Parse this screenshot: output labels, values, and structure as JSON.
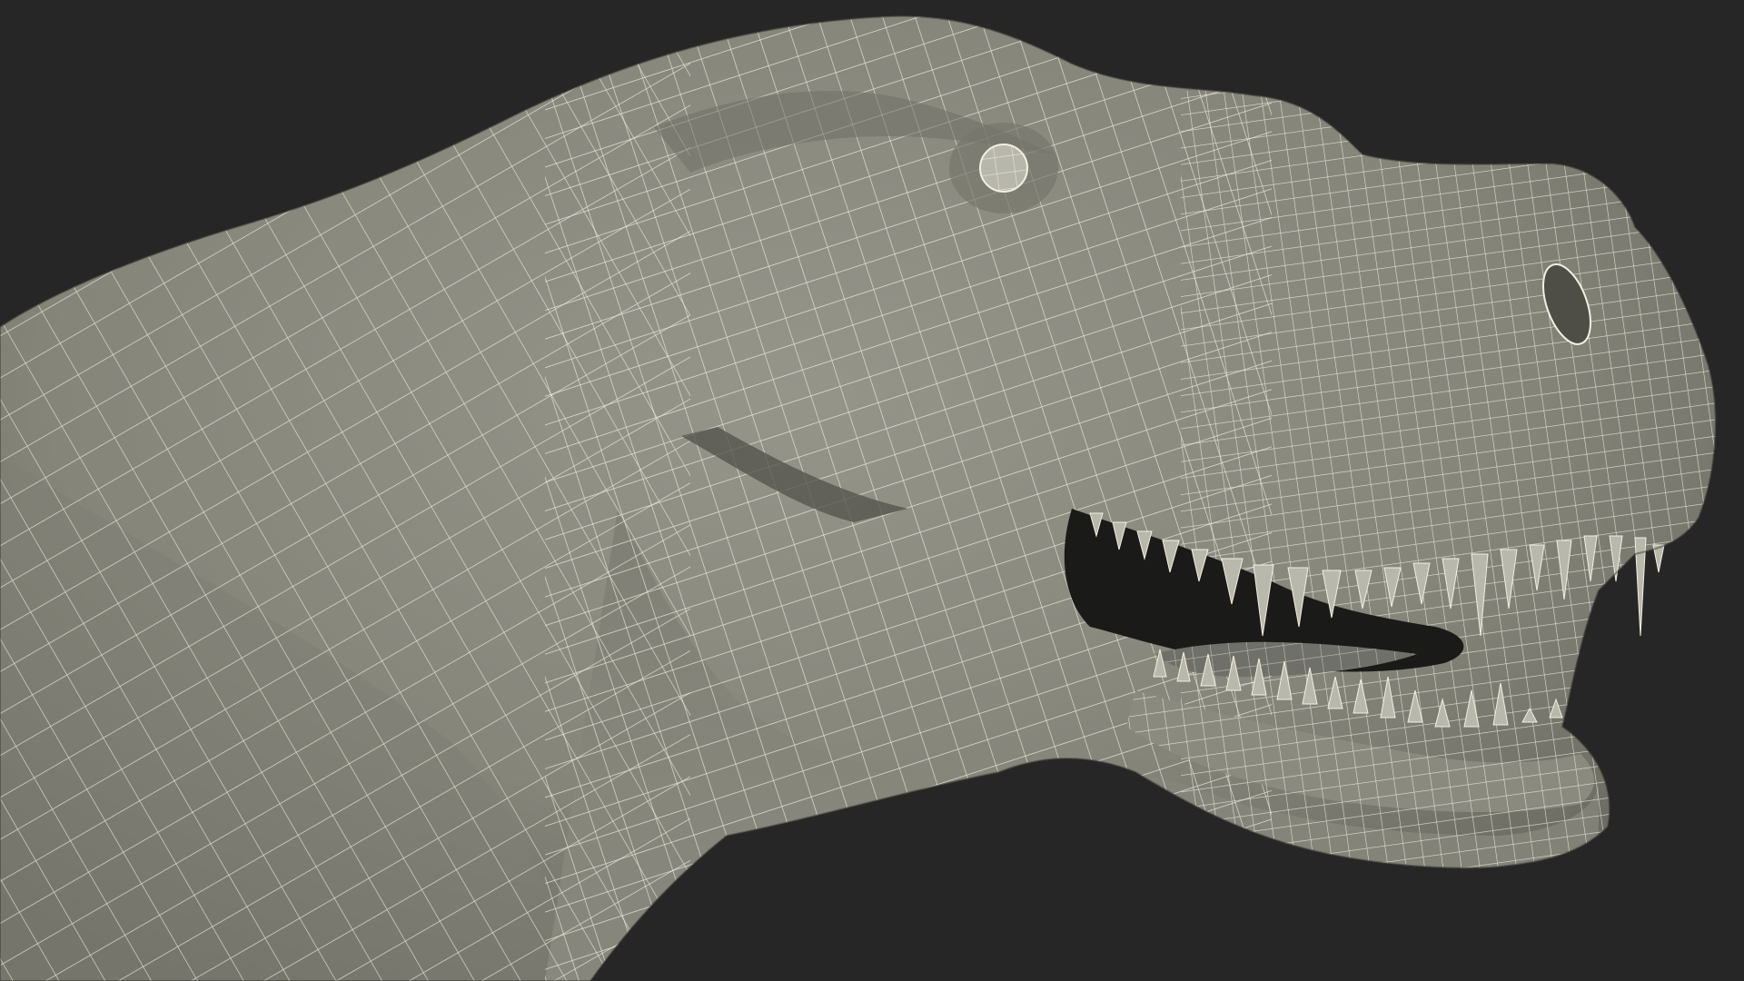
{
  "scene": {
    "subject": "t-rex-head-wireframe",
    "colors": {
      "background": "#262626",
      "surface": "#8a8a7f",
      "surface_shadow": "#5e5e56",
      "wire": "#f2efe2",
      "mouth": "#1a1a18",
      "tooth": "#b9b8ad"
    }
  }
}
